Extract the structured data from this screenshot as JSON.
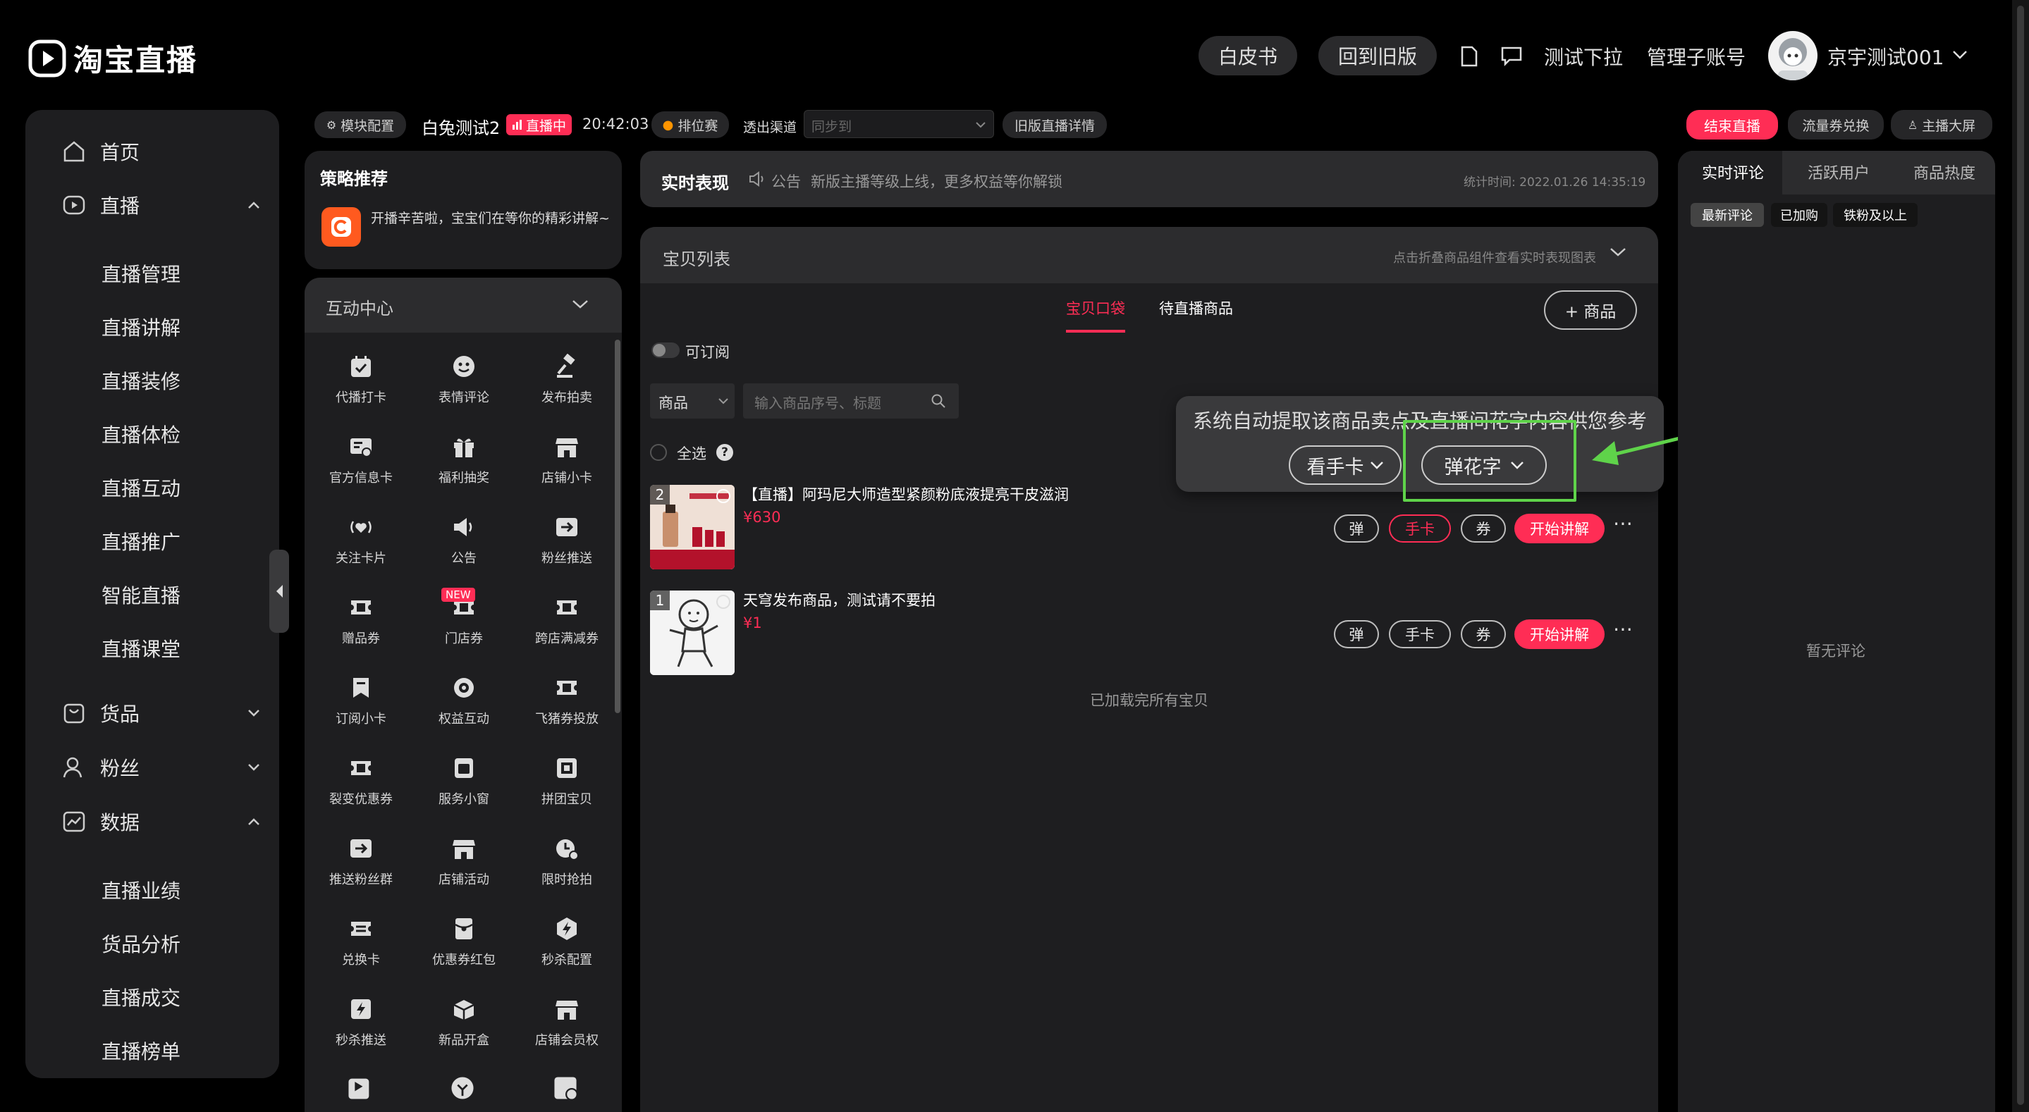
{
  "brand": {
    "logo_text": "淘宝直播"
  },
  "header": {
    "whitepaper": "白皮书",
    "back_old": "回到旧版",
    "test_dropdown": "测试下拉",
    "manage_sub": "管理子账号",
    "username": "京宇测试001"
  },
  "sidebar": {
    "home": "首页",
    "live": "直播",
    "live_items": [
      "直播管理",
      "直播讲解",
      "直播装修",
      "直播体检",
      "直播互动",
      "直播推广",
      "智能直播",
      "直播课堂"
    ],
    "goods": "货品",
    "fans": "粉丝",
    "data": "数据",
    "data_items": [
      "直播业绩",
      "货品分析",
      "直播成交",
      "直播榜单"
    ]
  },
  "status_bar": {
    "module_config": "模块配置",
    "room_name": "白兔测试2",
    "live_badge": "直播中",
    "timer": "20:42:03",
    "rank": "排位赛",
    "channel_label": "透出渠道",
    "channel_placeholder": "同步到",
    "old_detail": "旧版直播详情",
    "end_live": "结束直播",
    "coupon_exchange": "流量券兑换",
    "big_screen": "主播大屏"
  },
  "strategy": {
    "title": "策略推荐",
    "message": "开播辛苦啦，宝宝们在等你的精彩讲解~"
  },
  "interaction": {
    "title": "互动中心",
    "items": [
      [
        "代播打卡",
        "表情评论",
        "发布拍卖"
      ],
      [
        "官方信息卡",
        "福利抽奖",
        "店铺小卡"
      ],
      [
        "关注卡片",
        "公告",
        "粉丝推送"
      ],
      [
        "赠品券",
        "门店券",
        "跨店满减券"
      ],
      [
        "订阅小卡",
        "权益互动",
        "飞猪券投放"
      ],
      [
        "裂变优惠券",
        "服务小窗",
        "拼团宝贝"
      ],
      [
        "推送粉丝群",
        "店铺活动",
        "限时抢拍"
      ],
      [
        "兑换卡",
        "优惠券红包",
        "秒杀配置"
      ],
      [
        "秒杀推送",
        "新品开盒",
        "店铺会员权"
      ]
    ],
    "new_badge": "NEW"
  },
  "realtime": {
    "title": "实时表现",
    "announce_label": "公告",
    "announce_text": "新版主播等级上线，更多权益等你解锁",
    "stat_time": "统计时间: 2022.01.26 14:35:19"
  },
  "goods_list": {
    "title": "宝贝列表",
    "hint": "点击折叠商品组件查看实时表现图表",
    "tab_pocket": "宝贝口袋",
    "tab_pending": "待直播商品",
    "add_goods": "+ 商品",
    "subscribable": "可订阅",
    "filter_select": "商品",
    "search_placeholder": "输入商品序号、标题",
    "select_all": "全选",
    "footer": "已加载完所有宝贝",
    "products": [
      {
        "index": "2",
        "title": "【直播】阿玛尼大师造型紧颜粉底液提亮干皮滋润",
        "price": "¥630"
      },
      {
        "index": "1",
        "title": "天穹发布商品，测试请不要拍",
        "price": "¥1"
      }
    ],
    "actions": {
      "danmu": "弹",
      "card": "手卡",
      "coupon": "券",
      "start": "开始讲解"
    }
  },
  "tooltip": {
    "text": "系统自动提取该商品卖点及直播间花字内容供您参考",
    "view_card": "看手卡",
    "pop_text": "弹花字"
  },
  "right_panel": {
    "tabs": [
      "实时评论",
      "活跃用户",
      "商品热度"
    ],
    "chips": [
      "最新评论",
      "已加购",
      "铁粉及以上"
    ],
    "empty": "暂无评论"
  },
  "colors": {
    "accent_red": "#ff2d55",
    "highlight_green": "#5fd34a"
  }
}
